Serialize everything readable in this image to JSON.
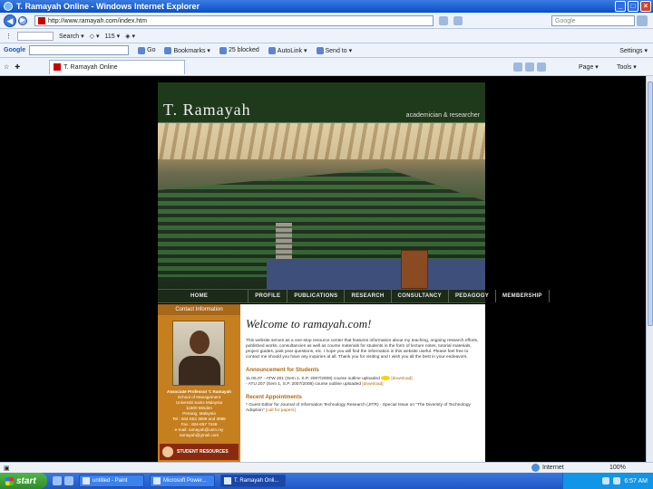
{
  "window": {
    "title": "T. Ramayah Online - Windows Internet Explorer"
  },
  "address_bar": {
    "url": "http://www.ramayah.com/index.htm",
    "search_placeholder": "Google"
  },
  "links_bar": {
    "items": [
      "Search ▾",
      "◇ ▾",
      "115 ▾",
      "◈ ▾"
    ]
  },
  "google_bar": {
    "label": "Google",
    "items": [
      "Go",
      "Bookmarks ▾",
      "25 blocked",
      "AutoLink ▾",
      "Send to ▾"
    ],
    "settings": "Settings ▾"
  },
  "tabs": {
    "active": "T. Ramayah Online"
  },
  "commands": {
    "page": "Page ▾",
    "tools": "Tools ▾"
  },
  "site": {
    "title": "T. Ramayah",
    "tagline": "academician & researcher",
    "nav": [
      "HOME",
      "PROFILE",
      "PUBLICATIONS",
      "RESEARCH",
      "CONSULTANCY",
      "PEDAGOGY",
      "MEMBERSHIP"
    ],
    "contact_heading": "Contact Information",
    "contact_lines": [
      "Associate Professor T. Ramayah",
      "School of Management",
      "Universiti Sains Malaysia",
      "11800 Minden",
      "Penang, Malaysia",
      "Tel : 604-653 3889 and 3889",
      "Fax : 604-657 7448",
      "e-mail: ramayah@usm.my",
      "ramayah@gmail.com"
    ],
    "student_resources": "STUDENT RESOURCES",
    "welcome": "Welcome to ramayah.com!",
    "intro": "This website serves as a one-stop resource center that features information about my teaching, ongoing research efforts, published works, consultancies as well as course materials for students in the form of lecture notes, tutorial materials, project guides, past year questions, etc. I hope you will find the information in this website useful. Please feel free to contact me should you have any inquiries at all. Thank you for visiting and I wish you all the best in your endeavors.",
    "announcements_heading": "Announcement for Students",
    "announcements": [
      {
        "text": "11.06.07 - ATW 201 (Sem 1, S.P. 2007/2008) course outline uploaded",
        "link": "[download]"
      },
      {
        "text": "- ATU 207 (Sem 1, S.P. 2007/2008) course outline uploaded",
        "link": "[download]"
      }
    ],
    "appointments_heading": "Recent Appointments",
    "appointments": [
      {
        "text": "* Guest Editor for Journal of Information Technology Research (JITR) - Special Issue on \"The Diversity of Technology Adoption\"",
        "link": "[call for papers]"
      }
    ]
  },
  "status": {
    "zone": "Internet",
    "zoom": "100%"
  },
  "taskbar": {
    "start": "start",
    "tasks": [
      "untitled - Paint",
      "Microsoft Power...",
      "T. Ramayah Onli..."
    ],
    "clock": "6:57 AM"
  }
}
